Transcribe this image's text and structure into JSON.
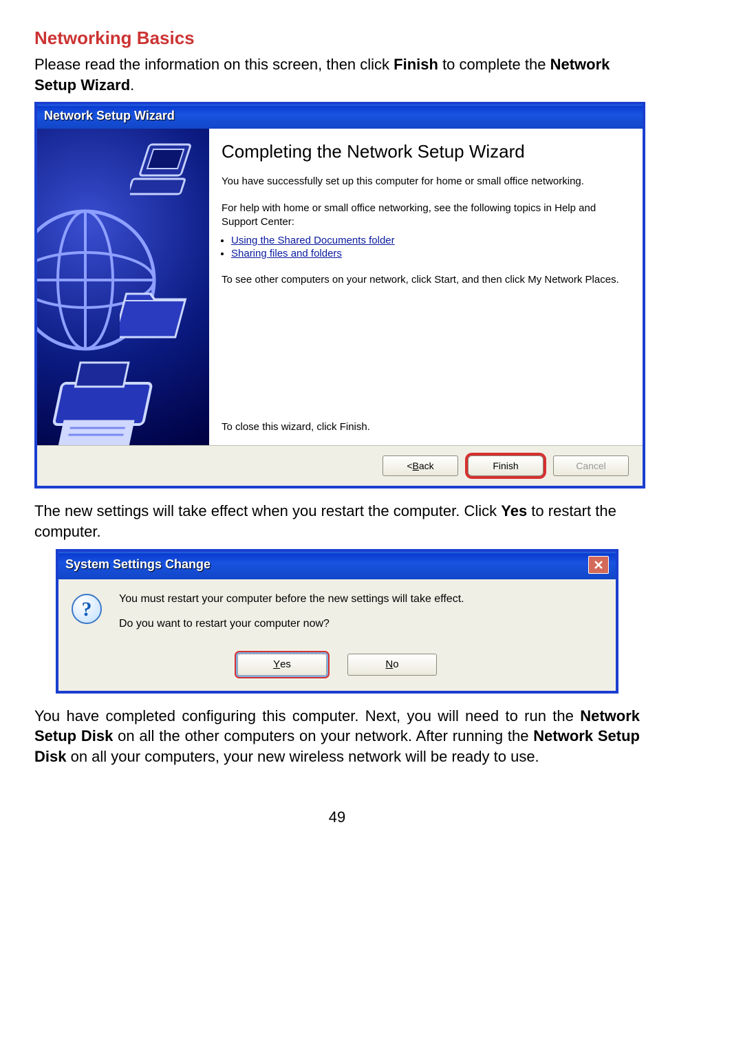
{
  "doc": {
    "section_title": "Networking Basics",
    "intro_a": "Please read the information on this screen, then click ",
    "intro_bold1": "Finish",
    "intro_b": " to complete the ",
    "intro_bold2": "Network Setup Wizard",
    "intro_c": ".",
    "mid_a": "The new settings will take effect when you restart the computer.  Click ",
    "mid_bold": "Yes",
    "mid_b": " to restart the computer.",
    "end_a": "You have completed configuring this computer.  Next, you will need to run the ",
    "end_bold1": "Network Setup Disk",
    "end_b": " on all the other computers on your network.  After running the ",
    "end_bold2": "Network Setup Disk",
    "end_c": " on all your computers, your new wireless network will be ready to use.",
    "page_number": "49"
  },
  "wizard": {
    "title": "Network Setup Wizard",
    "heading": "Completing the Network Setup Wizard",
    "p1": "You have successfully set up this computer for home or small office networking.",
    "p2": "For help with home or small office networking, see the following topics in Help and Support Center:",
    "link1": "Using the Shared Documents folder",
    "link2": "Sharing files and folders",
    "p3": "To see other computers on your network, click Start, and then click My Network Places.",
    "close_text": "To close this wizard, click Finish.",
    "btn_back_prefix": "< ",
    "btn_back_key": "B",
    "btn_back_rest": "ack",
    "btn_finish": "Finish",
    "btn_cancel": "Cancel"
  },
  "dialog": {
    "title": "System Settings Change",
    "line1": "You must restart your computer before the new settings will take effect.",
    "line2": "Do you want to restart your computer now?",
    "btn_yes_key": "Y",
    "btn_yes_rest": "es",
    "btn_no_key": "N",
    "btn_no_rest": "o"
  }
}
